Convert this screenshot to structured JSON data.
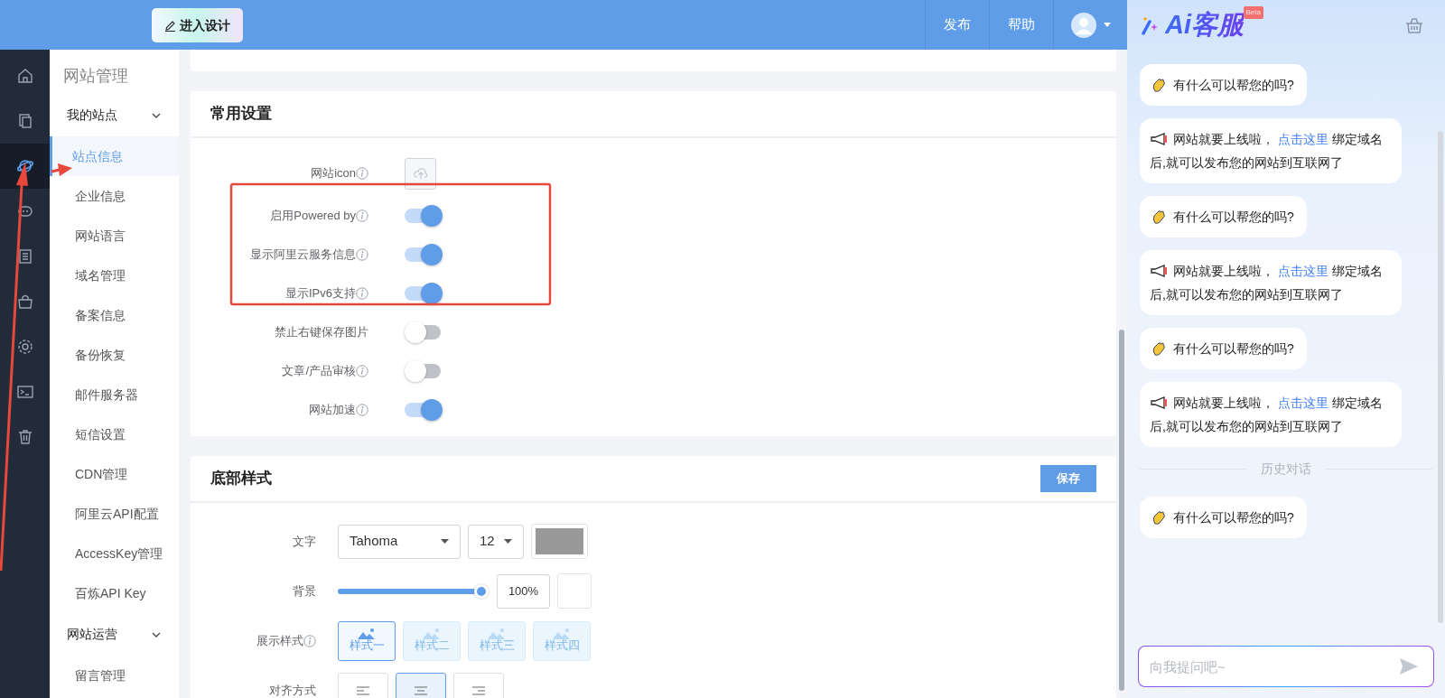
{
  "header": {
    "design_button": "进入设计",
    "actions": [
      {
        "label": "发布"
      },
      {
        "label": "帮助"
      }
    ]
  },
  "rail": [
    {
      "selected": false
    },
    {
      "selected": false
    },
    {
      "selected": true
    },
    {
      "selected": false
    },
    {
      "selected": false
    },
    {
      "selected": false
    },
    {
      "selected": false
    },
    {
      "selected": false
    },
    {
      "selected": false
    }
  ],
  "sidebar": {
    "title": "网站管理",
    "groups": [
      {
        "label": "我的站点",
        "expanded": true,
        "items": [
          {
            "label": "站点信息",
            "selected": true
          },
          {
            "label": "企业信息",
            "selected": false
          },
          {
            "label": "网站语言",
            "selected": false
          },
          {
            "label": "域名管理",
            "selected": false
          },
          {
            "label": "备案信息",
            "selected": false
          },
          {
            "label": "备份恢复",
            "selected": false
          },
          {
            "label": "邮件服务器",
            "selected": false
          },
          {
            "label": "短信设置",
            "selected": false
          },
          {
            "label": "CDN管理",
            "selected": false
          },
          {
            "label": "阿里云API配置",
            "selected": false
          },
          {
            "label": "AccessKey管理",
            "selected": false
          },
          {
            "label": "百炼API Key",
            "selected": false
          }
        ]
      },
      {
        "label": "网站运营",
        "expanded": true,
        "items": [
          {
            "label": "留言管理",
            "selected": false
          }
        ]
      }
    ]
  },
  "common_settings": {
    "title": "常用设置",
    "rows": [
      {
        "kind": "upload",
        "label": "网站icon",
        "info": true
      },
      {
        "kind": "toggle",
        "label": "启用Powered by",
        "info": true,
        "on": true
      },
      {
        "kind": "toggle",
        "label": "显示阿里云服务信息",
        "info": true,
        "on": true
      },
      {
        "kind": "toggle",
        "label": "显示IPv6支持",
        "info": true,
        "on": true
      },
      {
        "kind": "toggle",
        "label": "禁止右键保存图片",
        "info": false,
        "on": false
      },
      {
        "kind": "toggle",
        "label": "文章/产品审核",
        "info": true,
        "on": false
      },
      {
        "kind": "toggle",
        "label": "网站加速",
        "info": true,
        "on": true
      }
    ]
  },
  "footer_style": {
    "title": "底部样式",
    "save_button": "保存",
    "text_row": {
      "label": "文字",
      "font": "Tahoma",
      "size": "12",
      "color": "#999999"
    },
    "background_row": {
      "label": "背景",
      "level": 1.0,
      "reading": "100%",
      "color": "#ffffff"
    },
    "display_row": {
      "label": "展示样式",
      "info": true,
      "options": [
        {
          "label": "样式一",
          "selected": true
        },
        {
          "label": "样式二",
          "selected": false
        },
        {
          "label": "样式三",
          "selected": false
        },
        {
          "label": "样式四",
          "selected": false
        }
      ]
    },
    "align_row": {
      "label": "对齐方式",
      "options": [
        {
          "selected": false
        },
        {
          "selected": true
        },
        {
          "selected": false
        }
      ]
    }
  },
  "chat": {
    "title": "Ai客服",
    "badge": "Beta",
    "messages": [
      {
        "kind": "greeting",
        "text": "有什么可以帮您的吗?"
      },
      {
        "kind": "notice",
        "text": "网站就要上线啦，",
        "link": "点击这里",
        "tail": "绑定域名后,就可以发布您的网站到互联网了"
      },
      {
        "kind": "greeting",
        "text": "有什么可以帮您的吗?"
      },
      {
        "kind": "notice",
        "text": "网站就要上线啦，",
        "link": "点击这里",
        "tail": "绑定域名后,就可以发布您的网站到互联网了"
      },
      {
        "kind": "greeting",
        "text": "有什么可以帮您的吗?"
      },
      {
        "kind": "notice",
        "text": "网站就要上线啦，",
        "link": "点击这里",
        "tail": "绑定域名后,就可以发布您的网站到互联网了"
      }
    ],
    "divider": "历史对话",
    "history": [
      {
        "kind": "greeting",
        "text": "有什么可以帮您的吗?"
      }
    ],
    "input": {
      "placeholder": "向我提问吧~"
    }
  }
}
